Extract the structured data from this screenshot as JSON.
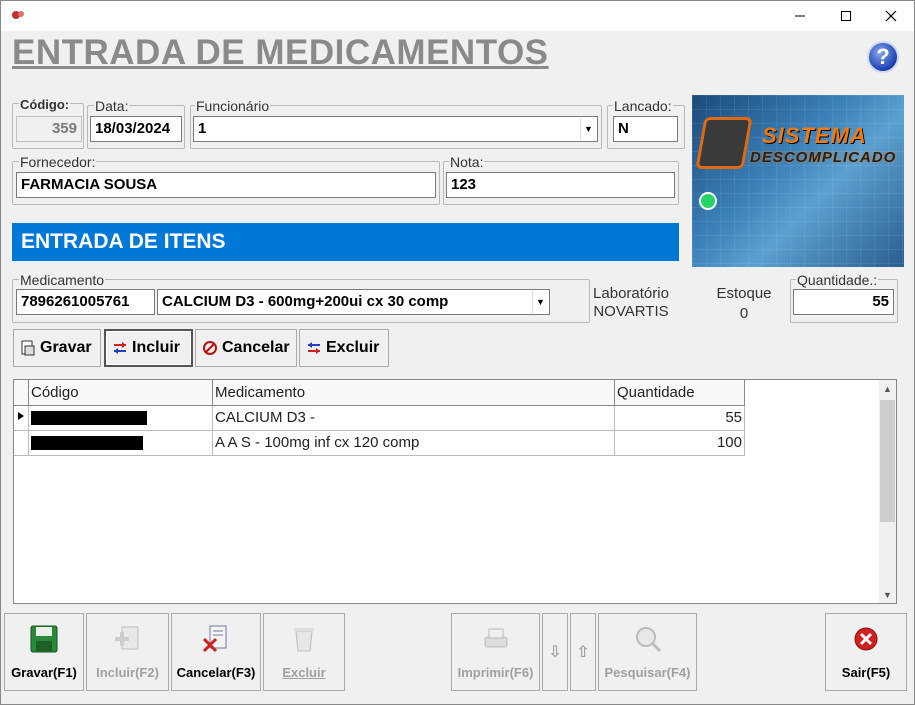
{
  "window": {
    "min_icon": "minimize-icon",
    "max_icon": "maximize-icon",
    "close_icon": "close-icon"
  },
  "page_title": "ENTRADA DE MEDICAMENTOS",
  "header": {
    "codigo": {
      "label": "Código:",
      "value": "359"
    },
    "data": {
      "label": "Data:",
      "value": "18/03/2024"
    },
    "funcionario": {
      "label": "Funcionário",
      "value": "1"
    },
    "lancado": {
      "label": "Lancado:",
      "value": "N"
    },
    "fornecedor": {
      "label": "Fornecedor:",
      "value": "FARMACIA SOUSA"
    },
    "nota": {
      "label": "Nota:",
      "value": "123"
    }
  },
  "banner": {
    "line1": "SISTEMA",
    "line2": "DESCOMPLICADO"
  },
  "section_title": "ENTRADA DE ITENS",
  "item": {
    "medicamento_label": "Medicamento",
    "barcode": "7896261005761",
    "medicamento_value": "CALCIUM D3 - 600mg+200ui cx 30 comp",
    "laboratorio_label": "Laboratório",
    "laboratorio_value": "NOVARTIS",
    "estoque_label": "Estoque",
    "estoque_value": "0",
    "quantidade_label": "Quantidade.:",
    "quantidade_value": "55"
  },
  "item_buttons": {
    "gravar": "Gravar",
    "incluir": "Incluir",
    "cancelar": "Cancelar",
    "excluir": "Excluir"
  },
  "grid": {
    "columns": [
      "Código",
      "Medicamento",
      "Quantidade"
    ],
    "rows": [
      {
        "medicamento": "CALCIUM D3 -",
        "quantidade": "55"
      },
      {
        "medicamento": "A A S - 100mg inf cx 120 comp",
        "quantidade": "100"
      }
    ]
  },
  "toolbar": {
    "gravar": "Gravar(F1)",
    "incluir": "Incluir(F2)",
    "cancelar": "Cancelar(F3)",
    "excluir": "Excluir",
    "imprimir": "Imprimir(F6)",
    "down": "⇩",
    "up": "⇧",
    "pesquisar": "Pesquisar(F4)",
    "sair": "Sair(F5)"
  },
  "colors": {
    "accent": "#0078d7",
    "title_gray": "#8a8a8a"
  }
}
